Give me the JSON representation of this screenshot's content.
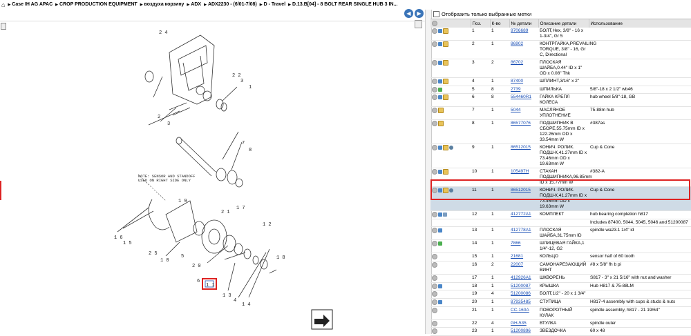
{
  "breadcrumb": [
    "Case IH AG APAC",
    "CROP PRODUCTION EQUIPMENT",
    "воздуха корзину",
    "ADX",
    "ADX2230 - (6/01-7/08)",
    "D - Travel",
    "D.13.B[04] - 8 BOLT REAR SINGLE HUB 3 IN..."
  ],
  "filter_label": "Отобразить только выбранные метки",
  "columns": [
    "Поз.",
    "К-во",
    "№ детали",
    "Описание детали",
    "Использование"
  ],
  "diagram_labels": {
    "l24": "2 4",
    "l22": "2 2",
    "l3a": "3",
    "l1a": "1",
    "l2a": "2",
    "l3b": "3",
    "l7": "7",
    "l8": "8",
    "l19": "1 9",
    "l16": "1 6",
    "l15": "1 5",
    "l25": "2 5",
    "l10": "1 0",
    "l5": "5",
    "l20": "2 0",
    "l21": "2 1",
    "l17": "1 7",
    "l12": "1 2",
    "l6": "6",
    "l13": "1 3",
    "l4": "4",
    "l14": "1 4",
    "l18": "1 8",
    "l11": "1 1",
    "note": "NOTE: SENSOR AND STANDOFF USED ON RIGHT SIDE ONLY"
  },
  "rows": [
    {
      "icons": [
        "grey",
        "blue",
        "box"
      ],
      "pos": "1",
      "qty": "1",
      "part": "9706689",
      "desc": "БОЛТ,Hex, 3/8\" - 16 x 1-3/4\", Gr 5",
      "use": ""
    },
    {
      "icons": [
        "grey",
        "blue",
        "box"
      ],
      "pos": "2",
      "qty": "1",
      "part": "86902",
      "desc": "КОНТРГАЙКА,PREVAILING TORQUE, 3/8\" - 16, Gr C, Directional",
      "use": ""
    },
    {
      "icons": [
        "grey",
        "blue",
        "box"
      ],
      "pos": "3",
      "qty": "2",
      "part": "86702",
      "desc": "ПЛОСКАЯ ШАЙБА,0.44\" ID x 1\" OD x 0.08\" Thk",
      "use": ""
    },
    {
      "icons": [
        "grey",
        "blue",
        "box"
      ],
      "pos": "4",
      "qty": "1",
      "part": "87400",
      "desc": "ШПЛИНТ,3/16\" x 2\"",
      "use": ""
    },
    {
      "icons": [
        "grey",
        "green"
      ],
      "pos": "5",
      "qty": "8",
      "part": "2739",
      "desc": "ШПИЛЬКА",
      "use": "5/8\"-18 x 2 1/2\" wb46"
    },
    {
      "icons": [
        "grey",
        "blue",
        "box"
      ],
      "pos": "6",
      "qty": "8",
      "part": "554460R1",
      "desc": "ГАЙКА КРЕПЛ КОЛЕСА",
      "use": "hub wheel 5/8\"-18, GB"
    },
    {
      "icons": [
        "grey",
        "box"
      ],
      "pos": "7",
      "qty": "1",
      "part": "5044",
      "desc": "МАСЛЯНОЕ УПЛОТНЕНИЕ",
      "use": "75-88m hub"
    },
    {
      "icons": [
        "grey",
        "box"
      ],
      "pos": "8",
      "qty": "1",
      "part": "86577076",
      "desc": "ПОДШИПНИК В СБОРЕ,55.75mm ID x 122.26mm OD x 33.54mm W",
      "use": "#387as"
    },
    {
      "icons": [
        "grey",
        "blue",
        "box",
        "wheel"
      ],
      "pos": "9",
      "qty": "1",
      "part": "86512015",
      "desc": "КОНИЧ. РОЛИК. ПОДШ-К,41.27mm ID x 73.46mm OD x 19.63mm W",
      "use": "Cup & Cone"
    },
    {
      "icons": [
        "grey",
        "blue",
        "box"
      ],
      "pos": "10",
      "qty": "1",
      "part": "105497H",
      "desc": "СТАКАН ПОДШИПНИКА,96.85mm ID x 15.77mm W",
      "use": "#382-A"
    },
    {
      "icons": [
        "grey",
        "blue",
        "box",
        "wheel"
      ],
      "pos": "11",
      "qty": "1",
      "part": "86512015",
      "desc": "КОНИЧ. РОЛИК. ПОДШ-К,41.27mm ID x 73.46mm OD x 19.63mm W",
      "use": "Cup & Cone",
      "selected": true
    },
    {
      "icons": [
        "grey",
        "blue",
        "wrench"
      ],
      "pos": "12",
      "qty": "1",
      "part": "412772A1",
      "desc": "КОМПЛЕКТ",
      "use": "hub bearing completion h817"
    },
    {
      "icons": [],
      "pos": "",
      "qty": "",
      "part": "",
      "desc": "",
      "use": "Includes 87400, 5044, 5045, 5046 and 51200087"
    },
    {
      "icons": [
        "grey",
        "blue"
      ],
      "pos": "13",
      "qty": "1",
      "part": "412778A1",
      "desc": "ПЛОСКАЯ ШАЙБА,31.75mm ID",
      "use": "spindle wa23.1 1/4\" id"
    },
    {
      "icons": [
        "grey",
        "green"
      ],
      "pos": "14",
      "qty": "1",
      "part": "7866",
      "desc": "ШЛИЦЕВАЯ ГАЙКА,1 1/4\"-12, G2",
      "use": ""
    },
    {
      "icons": [
        "grey"
      ],
      "pos": "15",
      "qty": "1",
      "part": "21681",
      "desc": "КОЛЬЦО",
      "use": "sensor half of 60 tooth"
    },
    {
      "icons": [
        "grey"
      ],
      "pos": "16",
      "qty": "2",
      "part": "22007",
      "desc": "САМОНАРЕЗАЮЩИЙ ВИНТ",
      "use": "#8 x 5/8\" fh b pi"
    },
    {
      "icons": [
        "grey"
      ],
      "pos": "17",
      "qty": "1",
      "part": "412926A1",
      "desc": "ШКВОРЕНЬ",
      "use": "S817 - 3\" x 21 5/16\" with nut and washer"
    },
    {
      "icons": [
        "grey",
        "blue"
      ],
      "pos": "18",
      "qty": "1",
      "part": "51200087",
      "desc": "КРЫШКА",
      "use": "Hub H817 & 75-88LM"
    },
    {
      "icons": [
        "grey"
      ],
      "pos": "19",
      "qty": "4",
      "part": "51200086",
      "desc": "БОЛТ,1/2\" - 20 x 1 3/4\"",
      "use": ""
    },
    {
      "icons": [
        "grey",
        "blue"
      ],
      "pos": "20",
      "qty": "1",
      "part": "87935485",
      "desc": "СТУПИЦА",
      "use": "H817-4 assembly with cups & studs & nuts"
    },
    {
      "icons": [
        "grey"
      ],
      "pos": "21",
      "qty": "1",
      "part": "CC-160A",
      "desc": "ПОВОРОТНЫЙ КУЛАК",
      "use": "spindle assembly, h817 - 21 19/64\""
    },
    {
      "icons": [
        "grey"
      ],
      "pos": "22",
      "qty": "4",
      "part": "GH-535",
      "desc": "ВТУЛКА",
      "use": "spindle outer"
    },
    {
      "icons": [
        "grey"
      ],
      "pos": "23",
      "qty": "1",
      "part": "51200896",
      "desc": "ЗВЕЗДОЧКА",
      "use": "60 x 48"
    }
  ]
}
